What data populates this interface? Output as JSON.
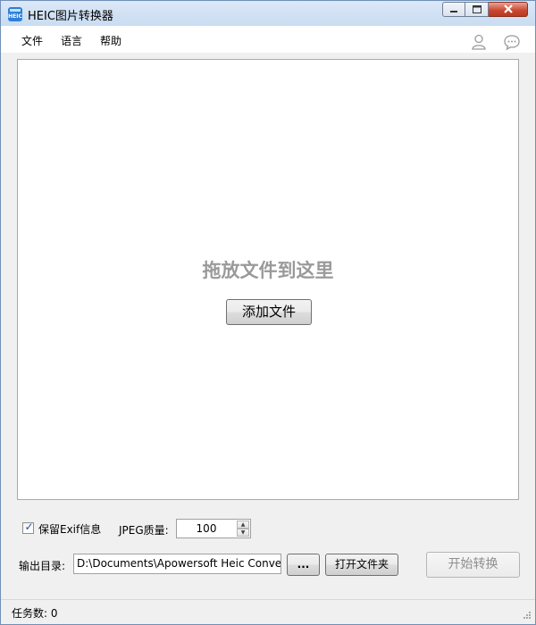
{
  "window": {
    "title": "HEIC图片转换器",
    "icon_text": "HEIC",
    "controls": {
      "minimize": "minimize-icon",
      "maximize": "maximize-icon",
      "close": "close-icon"
    }
  },
  "menu": {
    "items": [
      "文件",
      "语言",
      "帮助"
    ],
    "right_icons": [
      "user-icon",
      "chat-icon"
    ]
  },
  "dropzone": {
    "hint": "拖放文件到这里",
    "add_button": "添加文件"
  },
  "options": {
    "keep_exif_label": "保留Exif信息",
    "keep_exif_checked": true,
    "jpeg_quality_label": "JPEG质量:",
    "jpeg_quality_value": "100"
  },
  "output": {
    "label": "输出目录:",
    "path": "D:\\Documents\\Apowersoft Heic Conver",
    "browse_label": "...",
    "open_folder_label": "打开文件夹",
    "start_label": "开始转换"
  },
  "status": {
    "text": "任务数: 0"
  },
  "colors": {
    "hint_gray": "#9a9a9a",
    "close_red": "#c9452f",
    "accent_blue": "#2e7fd6"
  }
}
